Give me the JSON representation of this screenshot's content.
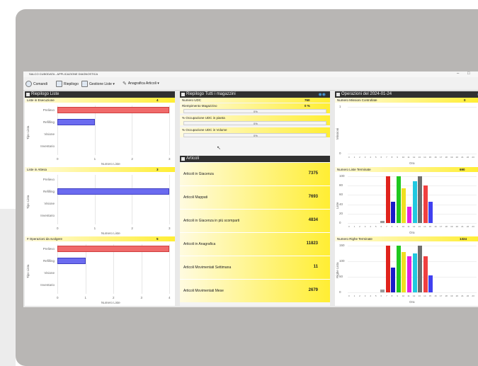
{
  "window": {
    "title": "SALCO CUBODATA - APPLICAZIONE DIAGNOSTICA"
  },
  "toolbar": {
    "items": [
      {
        "label": "Comandi",
        "icon": "gear-icon"
      },
      {
        "label": "Riepilogo",
        "icon": "document-icon"
      },
      {
        "label": "Gestione Liste ▾",
        "icon": "list-icon"
      },
      {
        "label": "Anagrafica Articoli ▾",
        "icon": "pencil-icon"
      }
    ]
  },
  "left": {
    "title": "Riepilogo Liste",
    "categories": [
      "Prelievo",
      "Refilling",
      "Visione",
      "Inventario"
    ],
    "xlabel": "Numero Liste",
    "ylabel": "Tipo Lista",
    "sections": [
      {
        "label": "Liste in Esecuzione",
        "value": "4"
      },
      {
        "label": "Liste in Attesa",
        "value": "3"
      },
      {
        "label": "# Operazioni da svolgere",
        "value": "5"
      }
    ]
  },
  "middle": {
    "title": "Riepilogo Tutti i magazzini",
    "stats": [
      {
        "label": "Numero UDC",
        "value": "760"
      },
      {
        "label": "Riempimento Magazzino",
        "value": "0 %",
        "pct": "0%"
      },
      {
        "label": "% Occupazione UDC in pianta",
        "pct": "0%"
      },
      {
        "label": "% Occupazione UDC in Volume",
        "pct": "0%"
      }
    ],
    "articles_title": "Articoli",
    "articles": [
      {
        "label": "Articoli in Giacenza",
        "value": "7375"
      },
      {
        "label": "Articoli Mappati",
        "value": "7693"
      },
      {
        "label": "Articoli in Giacenza in più scomparti",
        "value": "4834"
      },
      {
        "label": "Articoli in Anagrafica",
        "value": "11823"
      },
      {
        "label": "Articoli Movimentati Settimana",
        "value": "11"
      },
      {
        "label": "Articoli Movimentati Mese",
        "value": "2679"
      }
    ]
  },
  "right": {
    "title": "Operazioni del 2024-01-24",
    "xlabel": "Ora",
    "sections": [
      {
        "label": "Numero Missioni Controllate",
        "value": "0",
        "ylabel": "Missioni"
      },
      {
        "label": "Numero Liste Terminate",
        "value": "690",
        "ylabel": "Liste"
      },
      {
        "label": "Numero Righe Terminate",
        "value": "1324",
        "ylabel": "Righe Lista"
      }
    ]
  },
  "chart_data": [
    {
      "type": "bar",
      "orientation": "horizontal",
      "title": "Liste in Esecuzione",
      "categories": [
        "Prelievo",
        "Refilling",
        "Visione",
        "Inventario"
      ],
      "values": [
        3,
        1,
        0,
        0
      ],
      "xlabel": "Numero Liste",
      "ylabel": "Tipo Lista",
      "xlim": [
        0,
        3
      ],
      "xticks": [
        "0",
        "1",
        "2",
        "3"
      ],
      "colors": [
        "#f06a6a",
        "#6b6bf0",
        "#6b6bf0",
        "#6b6bf0"
      ]
    },
    {
      "type": "bar",
      "orientation": "horizontal",
      "title": "Liste in Attesa",
      "categories": [
        "Prelievo",
        "Refilling",
        "Visione",
        "Inventario"
      ],
      "values": [
        0,
        3,
        0,
        0
      ],
      "xlabel": "Numero Liste",
      "ylabel": "Tipo Lista",
      "xlim": [
        0,
        3
      ],
      "xticks": [
        "0",
        "1",
        "2",
        "3"
      ],
      "colors": [
        "#f06a6a",
        "#6b6bf0",
        "#6b6bf0",
        "#6b6bf0"
      ]
    },
    {
      "type": "bar",
      "orientation": "horizontal",
      "title": "# Operazioni da svolgere",
      "categories": [
        "Prelievo",
        "Refilling",
        "Visione",
        "Inventario"
      ],
      "values": [
        4,
        1,
        0,
        0
      ],
      "xlabel": "Numero Liste",
      "ylabel": "Tipo Lista",
      "xlim": [
        0,
        4
      ],
      "xticks": [
        "0",
        "1",
        "2",
        "3",
        "4"
      ],
      "colors": [
        "#f06a6a",
        "#6b6bf0",
        "#6b6bf0",
        "#6b6bf0"
      ]
    },
    {
      "type": "bar",
      "title": "Numero Missioni Controllate",
      "xlabel": "Ora",
      "ylabel": "Missioni",
      "ylim": [
        0,
        1
      ],
      "yticks": [
        "0",
        "1"
      ],
      "values": []
    },
    {
      "type": "bar",
      "title": "Numero Liste Terminate",
      "xlabel": "Ora",
      "ylabel": "Liste",
      "ylim": [
        0,
        100
      ],
      "yticks": [
        "0",
        "20",
        "40",
        "60",
        "80",
        "100"
      ],
      "values": [
        5,
        100,
        45,
        100,
        75,
        35,
        90,
        100,
        80,
        45
      ],
      "colors": [
        "#9a9a9a",
        "#e0231c",
        "#1a1ac8",
        "#20c820",
        "#f0e020",
        "#e020e0",
        "#20c8e0",
        "#6e6e6e",
        "#f04040",
        "#4040f0"
      ]
    },
    {
      "type": "bar",
      "title": "Numero Righe Terminate",
      "xlabel": "Ora",
      "ylabel": "Righe Lista",
      "ylim": [
        0,
        150
      ],
      "yticks": [
        "0",
        "50",
        "100",
        "150"
      ],
      "values": [
        10,
        150,
        80,
        150,
        130,
        115,
        125,
        150,
        115,
        55
      ],
      "colors": [
        "#9a9a9a",
        "#e0231c",
        "#1a1ac8",
        "#20c820",
        "#f0e020",
        "#e020e0",
        "#20c8e0",
        "#6e6e6e",
        "#f04040",
        "#4040f0"
      ]
    }
  ]
}
